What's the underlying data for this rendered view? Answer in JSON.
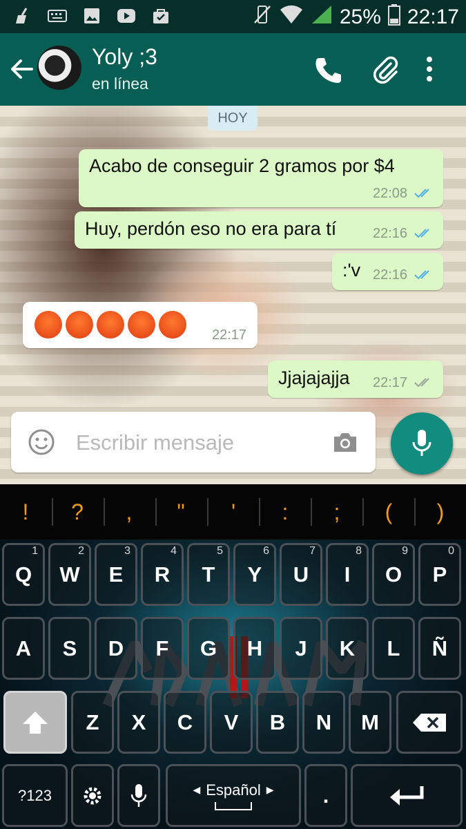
{
  "status_bar": {
    "battery": "25%",
    "time": "22:17"
  },
  "header": {
    "contact_name": "Yoly ;3",
    "contact_status": "en línea"
  },
  "chat": {
    "day_label": "HOY",
    "messages": [
      {
        "text": "Acabo de conseguir 2 gramos por $4",
        "time": "22:08"
      },
      {
        "text": "Huy, perdón eso no era para tí",
        "time": "22:16"
      },
      {
        "text": ":'v",
        "time": "22:16"
      },
      {
        "time": "22:17"
      },
      {
        "text": "Jjajajajja",
        "time": "22:17"
      }
    ]
  },
  "composer": {
    "placeholder": "Escribir mensaje"
  },
  "keyboard": {
    "suggestions": [
      "!",
      "?",
      ",",
      "\"",
      "'",
      ":",
      ";",
      "(",
      ")"
    ],
    "row1": [
      {
        "label": "Q",
        "hint": "1"
      },
      {
        "label": "W",
        "hint": "2"
      },
      {
        "label": "E",
        "hint": "3"
      },
      {
        "label": "R",
        "hint": "4"
      },
      {
        "label": "T",
        "hint": "5"
      },
      {
        "label": "Y",
        "hint": "6"
      },
      {
        "label": "U",
        "hint": "7"
      },
      {
        "label": "I",
        "hint": "8"
      },
      {
        "label": "O",
        "hint": "9"
      },
      {
        "label": "P",
        "hint": "0"
      }
    ],
    "row2": [
      "A",
      "S",
      "D",
      "F",
      "G",
      "H",
      "J",
      "K",
      "L",
      "Ñ"
    ],
    "row3": [
      "Z",
      "X",
      "C",
      "V",
      "B",
      "N",
      "M"
    ],
    "sym_label": "?123",
    "space_label": "Español",
    "period_label": "."
  }
}
